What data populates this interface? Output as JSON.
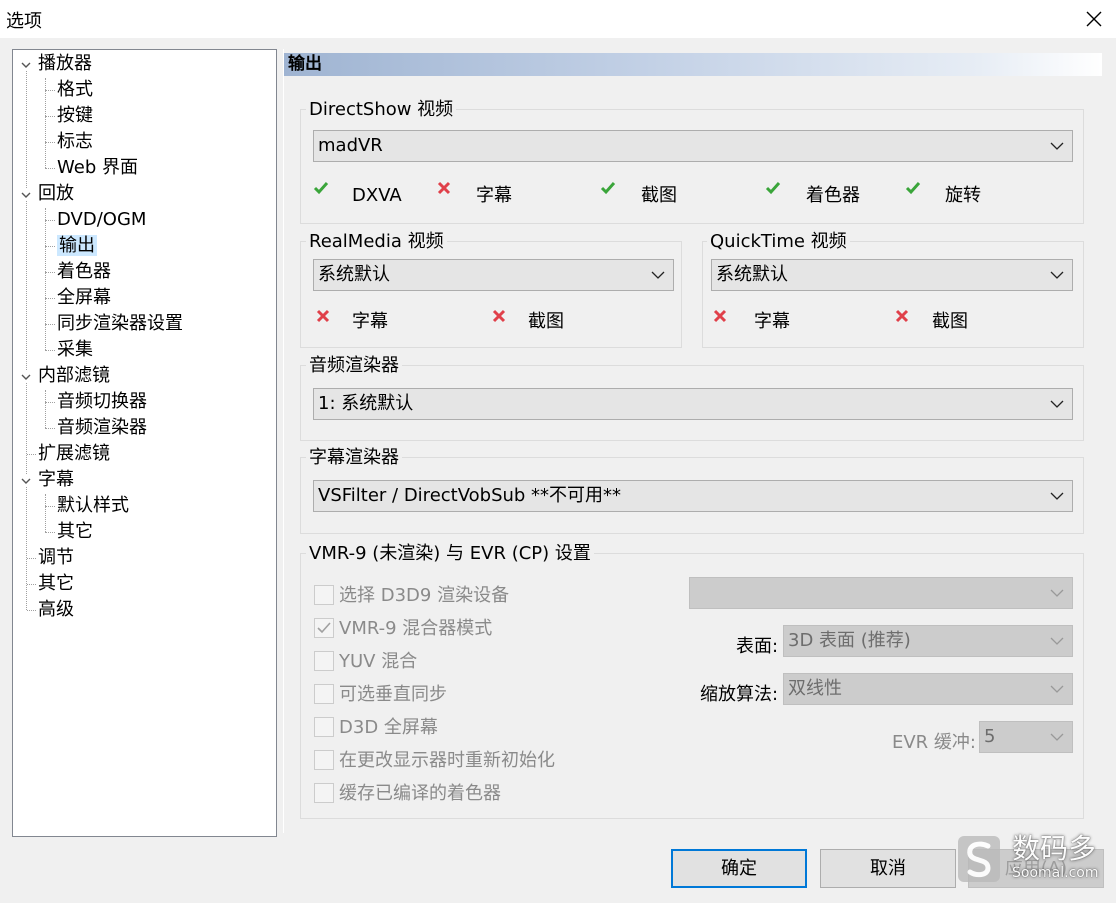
{
  "window": {
    "title": "选项"
  },
  "tree": {
    "items": [
      {
        "label": "播放器",
        "level": 0,
        "expanded": true
      },
      {
        "label": "格式",
        "level": 1
      },
      {
        "label": "按键",
        "level": 1
      },
      {
        "label": "标志",
        "level": 1
      },
      {
        "label": "Web 界面",
        "level": 1
      },
      {
        "label": "回放",
        "level": 0,
        "expanded": true
      },
      {
        "label": "DVD/OGM",
        "level": 1
      },
      {
        "label": "输出",
        "level": 1,
        "selected": true
      },
      {
        "label": "着色器",
        "level": 1
      },
      {
        "label": "全屏幕",
        "level": 1
      },
      {
        "label": "同步渲染器设置",
        "level": 1
      },
      {
        "label": "采集",
        "level": 1
      },
      {
        "label": "内部滤镜",
        "level": 0,
        "expanded": true
      },
      {
        "label": "音频切换器",
        "level": 1
      },
      {
        "label": "音频渲染器",
        "level": 1
      },
      {
        "label": "扩展滤镜",
        "level": 0
      },
      {
        "label": "字幕",
        "level": 0,
        "expanded": true
      },
      {
        "label": "默认样式",
        "level": 1
      },
      {
        "label": "其它",
        "level": 1
      },
      {
        "label": "调节",
        "level": 0
      },
      {
        "label": "其它",
        "level": 0
      },
      {
        "label": "高级",
        "level": 0
      }
    ]
  },
  "page": {
    "header": "输出",
    "directshow": {
      "label": "DirectShow 视频",
      "value": "madVR",
      "flags": [
        {
          "label": "DXVA",
          "ok": true
        },
        {
          "label": "字幕",
          "ok": false
        },
        {
          "label": "截图",
          "ok": true
        },
        {
          "label": "着色器",
          "ok": true
        },
        {
          "label": "旋转",
          "ok": true
        }
      ]
    },
    "realmedia": {
      "label": "RealMedia 视频",
      "value": "系统默认",
      "flags": [
        {
          "label": "字幕",
          "ok": false
        },
        {
          "label": "截图",
          "ok": false
        }
      ]
    },
    "quicktime": {
      "label": "QuickTime 视频",
      "value": "系统默认",
      "flags": [
        {
          "label": "字幕",
          "ok": false
        },
        {
          "label": "截图",
          "ok": false
        }
      ]
    },
    "audio": {
      "label": "音频渲染器",
      "value": "1: 系统默认"
    },
    "subtitle": {
      "label": "字幕渲染器",
      "value": "VSFilter / DirectVobSub **不可用**"
    },
    "vmr": {
      "label": "VMR-9 (未渲染) 与 EVR (CP) 设置",
      "checkboxes": [
        {
          "label": "选择 D3D9 渲染设备",
          "checked": false
        },
        {
          "label": "VMR-9 混合器模式",
          "checked": true
        },
        {
          "label": "YUV 混合",
          "checked": false
        },
        {
          "label": "可选垂直同步",
          "checked": false
        },
        {
          "label": "D3D 全屏幕",
          "checked": false
        },
        {
          "label": "在更改显示器时重新初始化",
          "checked": false
        },
        {
          "label": "缓存已编译的着色器",
          "checked": false
        }
      ],
      "device_value": "",
      "surface_label": "表面:",
      "surface_value": "3D 表面 (推荐)",
      "resize_label": "缩放算法:",
      "resize_value": "双线性",
      "evr_label": "EVR 缓冲:",
      "evr_value": "5"
    }
  },
  "buttons": {
    "ok": "确定",
    "cancel": "取消",
    "apply": "应用(A)"
  },
  "watermark": {
    "name": "数码多",
    "site": "Soomal.com"
  },
  "colors": {
    "ok_check": "#3aa53a",
    "fail_cross": "#e0404a",
    "selection": "#cce8ff",
    "focus": "#0078d7"
  }
}
